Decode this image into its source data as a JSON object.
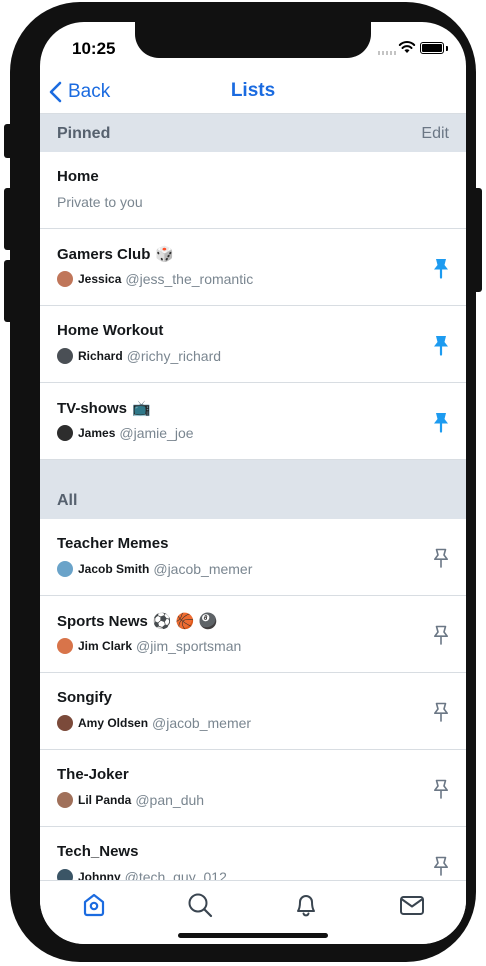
{
  "status_bar": {
    "time": "10:25"
  },
  "nav": {
    "back_label": "Back",
    "title": "Lists"
  },
  "pinned_section": {
    "title": "Pinned",
    "edit_label": "Edit"
  },
  "all_section": {
    "title": "All"
  },
  "home_list": {
    "name": "Home",
    "subtitle": "Private to you"
  },
  "pinned_lists": [
    {
      "name": "Gamers Club",
      "emoji": "🎲",
      "owner": "Jessica",
      "handle": "@jess_the_romantic",
      "avatar_color": "#c0765a",
      "pinned": true
    },
    {
      "name": "Home Workout",
      "emoji": "",
      "owner": "Richard",
      "handle": "@richy_richard",
      "avatar_color": "#4a4f55",
      "pinned": true
    },
    {
      "name": "TV-shows",
      "emoji": "📺",
      "owner": "James",
      "handle": "@jamie_joe",
      "avatar_color": "#2d2d2d",
      "pinned": true
    }
  ],
  "all_lists": [
    {
      "name": "Teacher Memes",
      "emoji": "",
      "owner": "Jacob Smith",
      "handle": "@jacob_memer",
      "avatar_color": "#6aa3c9",
      "pinned": false
    },
    {
      "name": "Sports News",
      "emoji": "⚽ 🏀 🎱",
      "owner": "Jim Clark",
      "handle": "@jim_sportsman",
      "avatar_color": "#d8744a",
      "pinned": false
    },
    {
      "name": "Songify",
      "emoji": "",
      "owner": "Amy Oldsen",
      "handle": "@jacob_memer",
      "avatar_color": "#7b4a3a",
      "pinned": false
    },
    {
      "name": "The-Joker",
      "emoji": "",
      "owner": "Lil Panda",
      "handle": "@pan_duh",
      "avatar_color": "#a0705a",
      "pinned": false
    },
    {
      "name": "Tech_News",
      "emoji": "",
      "owner": "Johnny",
      "handle": "@tech_guy_012",
      "avatar_color": "#3b5566",
      "pinned": false
    }
  ],
  "tabs": [
    {
      "name": "home",
      "icon": "home-icon",
      "active": true
    },
    {
      "name": "search",
      "icon": "search-icon",
      "active": false
    },
    {
      "name": "notifications",
      "icon": "bell-icon",
      "active": false
    },
    {
      "name": "messages",
      "icon": "mail-icon",
      "active": false
    }
  ],
  "colors": {
    "accent": "#1b6be0",
    "pin_active": "#1d9bf0",
    "pin_inactive": "#6b7785",
    "section_bg": "#dde3ea"
  }
}
